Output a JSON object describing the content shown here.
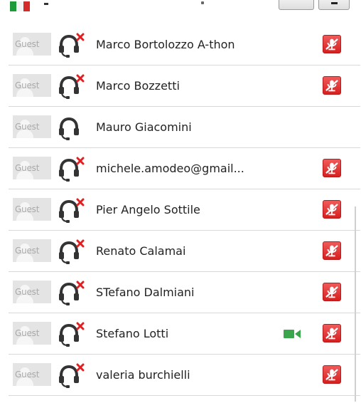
{
  "avatar_label": "Guest",
  "colors": {
    "mute_button": "#e33a3a",
    "video_icon": "#3aa64b",
    "headset_disconnected_x": "#e02020",
    "headset": "#333333"
  },
  "participants": [
    {
      "name": "Marco Bortolozzo A-thon",
      "audio_disconnected": true,
      "muted": true,
      "video": false
    },
    {
      "name": "Marco Bozzetti",
      "audio_disconnected": true,
      "muted": true,
      "video": false
    },
    {
      "name": "Mauro Giacomini",
      "audio_disconnected": false,
      "muted": false,
      "video": false
    },
    {
      "name": "michele.amodeo@gmail...",
      "audio_disconnected": true,
      "muted": true,
      "video": false
    },
    {
      "name": "Pier Angelo Sottile",
      "audio_disconnected": true,
      "muted": true,
      "video": false
    },
    {
      "name": "Renato Calamai",
      "audio_disconnected": true,
      "muted": true,
      "video": false
    },
    {
      "name": "STefano Dalmiani",
      "audio_disconnected": true,
      "muted": true,
      "video": false
    },
    {
      "name": "Stefano Lotti",
      "audio_disconnected": true,
      "muted": true,
      "video": true
    },
    {
      "name": "valeria burchielli",
      "audio_disconnected": true,
      "muted": true,
      "video": false
    }
  ]
}
